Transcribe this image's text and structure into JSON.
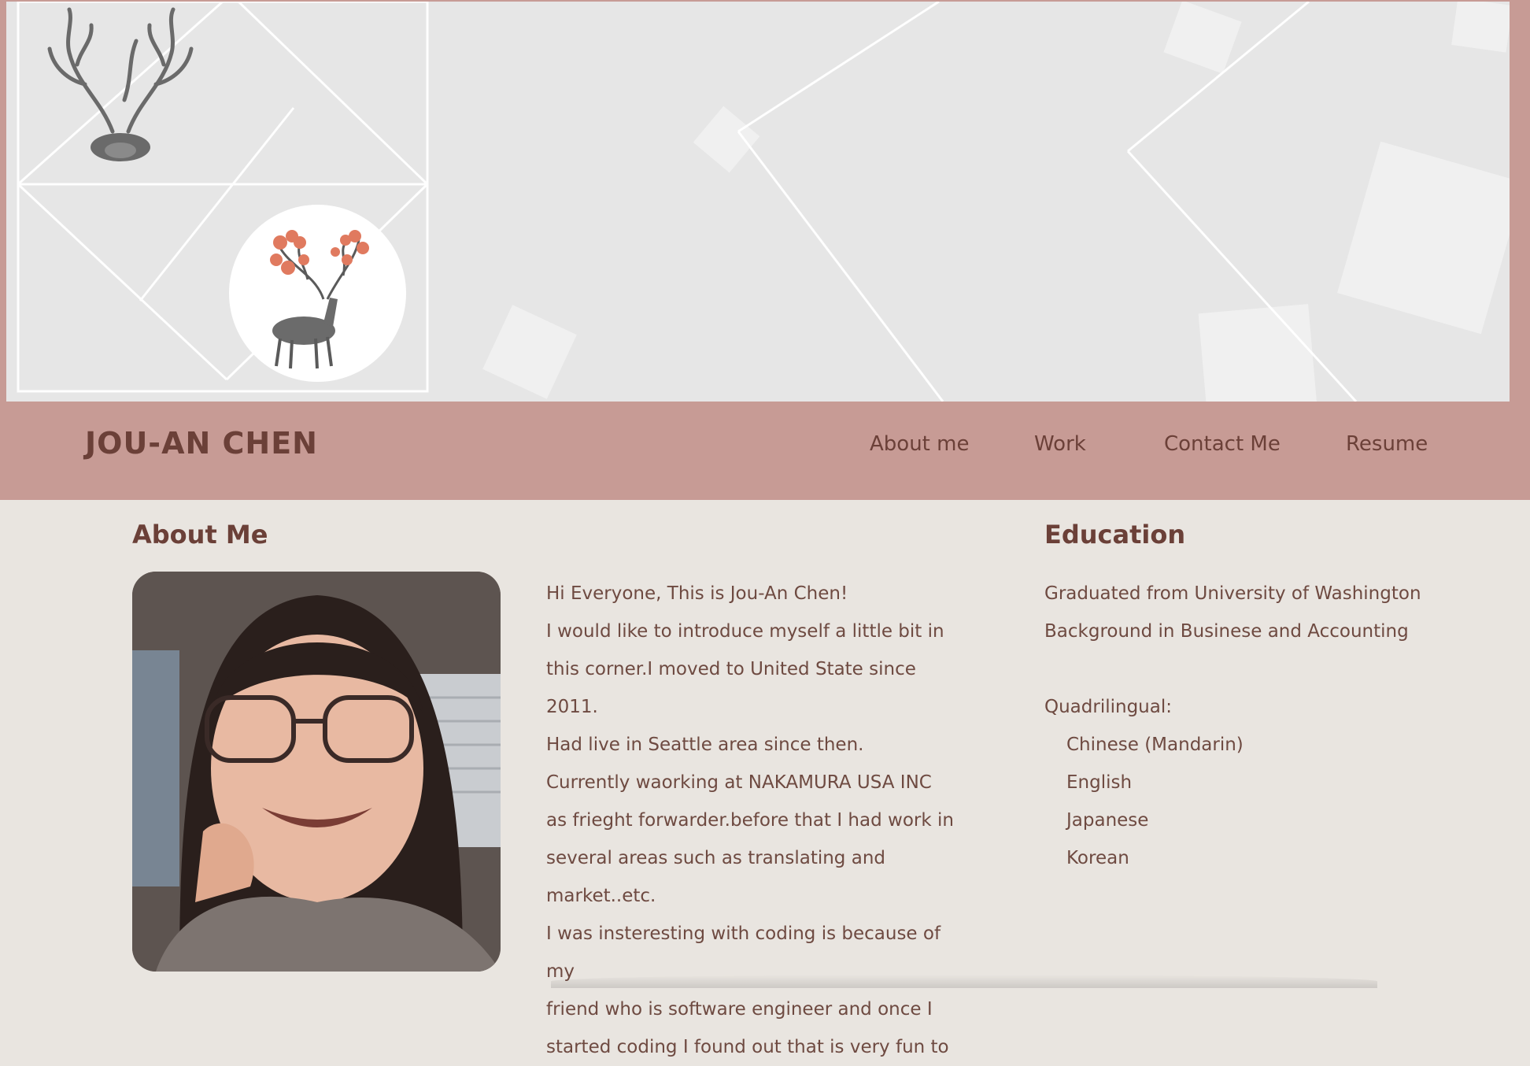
{
  "brand": "JOU-AN CHEN",
  "nav": {
    "items": [
      "About me",
      "Work",
      "Contact Me",
      "Resume"
    ]
  },
  "about": {
    "heading": "About Me",
    "lines": [
      "Hi Everyone, This is Jou-An Chen!",
      "I would like to introduce myself a little bit in",
      "this corner.I moved to United State since 2011.",
      "Had live in Seattle area since then.",
      "Currently waorking at NAKAMURA USA INC",
      "as frieght forwarder.before that I had work in",
      "several areas such as translating and",
      "market..etc.",
      "I was insteresting with coding is because of my",
      "friend who is software engineer and once I",
      "started coding I found out that is very fun to"
    ]
  },
  "education": {
    "heading": "Education",
    "lines": [
      "Graduated from University of Washington",
      "Background in Businese and Accounting"
    ],
    "languages_label": "Quadrilingual:",
    "languages": [
      "Chinese (Mandarin)",
      "English",
      "Japanese",
      "Korean"
    ]
  },
  "colors": {
    "accent": "#c79b95",
    "text": "#6e4a41",
    "background": "#e9e5e0"
  },
  "icons": [
    "deer-antler-illustration",
    "deer-circle-illustration",
    "profile-photo"
  ]
}
